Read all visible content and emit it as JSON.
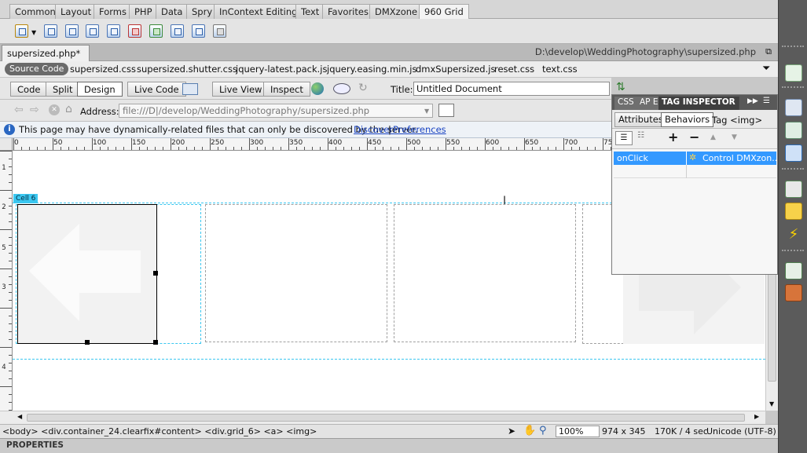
{
  "insert_bar": {
    "tabs": [
      {
        "label": "Common"
      },
      {
        "label": "Layout"
      },
      {
        "label": "Forms"
      },
      {
        "label": "PHP"
      },
      {
        "label": "Data"
      },
      {
        "label": "Spry"
      },
      {
        "label": "InContext Editing"
      },
      {
        "label": "Text"
      },
      {
        "label": "Favorites"
      },
      {
        "label": "DMXzone"
      },
      {
        "label": "960 Grid"
      }
    ],
    "active_tab": "960 Grid"
  },
  "document": {
    "tab_label": "supersized.php*",
    "path": "D:\\develop\\WeddingPhotography\\supersized.php",
    "source_code_label": "Source Code",
    "related_files": [
      "supersized.css",
      "supersized.shutter.css",
      "jquery-latest.pack.js",
      "jquery.easing.min.js",
      "dmxSupersized.js",
      "reset.css",
      "text.css"
    ]
  },
  "doc_toolbar": {
    "code_label": "Code",
    "split_label": "Split",
    "design_label": "Design",
    "live_code_label": "Live Code",
    "live_view_label": "Live View",
    "inspect_label": "Inspect",
    "title_label": "Title:",
    "title_value": "Untitled Document"
  },
  "address_bar": {
    "label": "Address:",
    "value": "file:///D|/develop/WeddingPhotography/supersized.php"
  },
  "info_bar": {
    "message": "This page may have dynamically-related files that can only be discovered by the server.",
    "discover_link": "Discover",
    "separator": "|",
    "preferences_link": "Preferences"
  },
  "ruler": {
    "labels": [
      "0",
      "50",
      "100",
      "150",
      "200",
      "250",
      "300",
      "350",
      "400",
      "450",
      "500",
      "550",
      "600",
      "650",
      "700",
      "75"
    ],
    "v_labels": [
      "1",
      "2",
      "5",
      "3",
      "4"
    ]
  },
  "canvas": {
    "cell_label": "Cell 6"
  },
  "status_bar": {
    "tag_selector": "<body> <div.container_24.clearfix#content> <div.grid_6> <a> <img>",
    "zoom": "100%",
    "dimensions": "974 x 345",
    "download": "170K / 4 sec",
    "encoding": "Unicode (UTF-8)"
  },
  "properties_bar": {
    "label": "PROPERTIES"
  },
  "tag_inspector": {
    "tabs": [
      {
        "label": "CSS"
      },
      {
        "label": "AP E"
      },
      {
        "label": "TAG INSPECTOR"
      }
    ],
    "sub_tabs": {
      "attributes_label": "Attributes",
      "behaviors_label": "Behaviors",
      "tag_label": "Tag <img>"
    },
    "add_label": "+",
    "remove_label": "−",
    "behaviors": [
      {
        "event": "onClick",
        "action": "Control DMXzon..."
      }
    ]
  },
  "colors": {
    "selection_blue": "#3399ff",
    "cell_label_cyan": "#3bc7f0",
    "link_blue": "#1a44c2"
  }
}
